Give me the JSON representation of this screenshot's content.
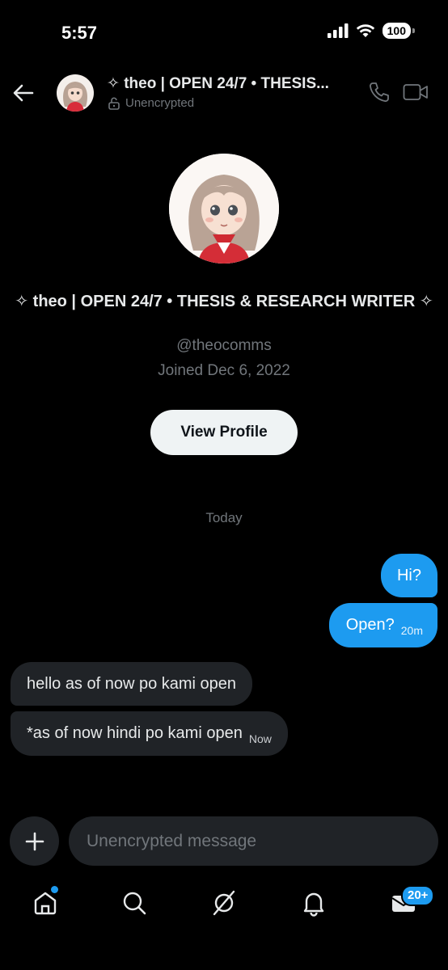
{
  "status_bar": {
    "time": "5:57",
    "battery": "100"
  },
  "header": {
    "name": "✧ theo | OPEN 24/7 • THESIS...",
    "encryption": "Unencrypted"
  },
  "profile": {
    "display_name": "✧ theo | OPEN 24/7 • THESIS & RESEARCH WRITER ✧",
    "handle": "@theocomms",
    "joined": "Joined Dec 6, 2022",
    "view_profile_label": "View Profile"
  },
  "conversation": {
    "day_separator": "Today",
    "messages": [
      {
        "direction": "outgoing",
        "text": "Hi?",
        "time": ""
      },
      {
        "direction": "outgoing",
        "text": "Open?",
        "time": "20m"
      },
      {
        "direction": "incoming",
        "text": "hello as of now po kami open",
        "time": ""
      },
      {
        "direction": "incoming",
        "text": "*as of now hindi po kami open",
        "time": "Now"
      }
    ]
  },
  "composer": {
    "placeholder": "Unencrypted message"
  },
  "tabbar": {
    "items": [
      "home-icon",
      "search-icon",
      "grok-icon",
      "notifications-icon",
      "messages-icon"
    ],
    "messages_badge": "20+"
  },
  "colors": {
    "accent": "#1d9bf0",
    "background": "#000000",
    "incoming_bubble": "#202327",
    "muted": "#71767b"
  }
}
